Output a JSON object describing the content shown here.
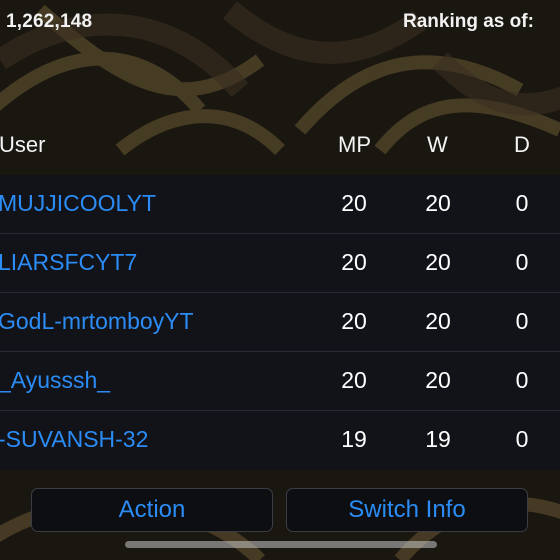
{
  "header": {
    "count_text": "1,262,148",
    "ranking_label": "Ranking as of:"
  },
  "table": {
    "columns": [
      "User",
      "MP",
      "W",
      "D"
    ],
    "rows": [
      {
        "user": "MUJJICOOLYT",
        "mp": "20",
        "w": "20",
        "d": "0"
      },
      {
        "user": "LIARSFCYT7",
        "mp": "20",
        "w": "20",
        "d": "0"
      },
      {
        "user": "GodL-mrtomboyYT",
        "mp": "20",
        "w": "20",
        "d": "0"
      },
      {
        "user": "_Ayusssh_",
        "mp": "20",
        "w": "20",
        "d": "0"
      },
      {
        "user": "-SUVANSH-32",
        "mp": "19",
        "w": "19",
        "d": "0"
      }
    ]
  },
  "buttons": {
    "action": "Action",
    "switch_info": "Switch Info"
  },
  "colors": {
    "accent": "#2b8cf5",
    "table_bg": "#121319",
    "background": "#17140f"
  }
}
